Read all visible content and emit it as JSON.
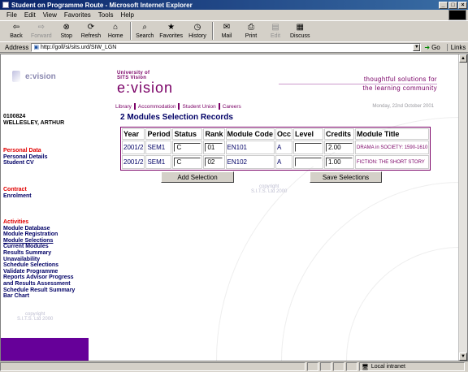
{
  "window": {
    "title": "Student on Programme Route - Microsoft Internet Explorer",
    "minimize": "_",
    "maximize": "□",
    "close": "×"
  },
  "menu": [
    "File",
    "Edit",
    "View",
    "Favorites",
    "Tools",
    "Help"
  ],
  "toolbar": {
    "back": "Back",
    "forward": "Forward",
    "stop": "Stop",
    "refresh": "Refresh",
    "home": "Home",
    "search": "Search",
    "favorites": "Favorites",
    "history": "History",
    "mail": "Mail",
    "print": "Print",
    "edit": "Edit",
    "discuss": "Discuss"
  },
  "address": {
    "label": "Address",
    "url": "http://goll/si/sits.urd/SIW_LGN",
    "go": "Go",
    "links": "Links"
  },
  "sidebar": {
    "logo_text": "e:vision",
    "student_id": "0100824",
    "student_name": "WELLESLEY, ARTHUR",
    "sections": [
      {
        "heading": "Personal Data",
        "items": [
          "Personal Details",
          "Student CV"
        ]
      },
      {
        "heading": "Contract",
        "items": [
          "Enrolment"
        ]
      },
      {
        "heading": "Activities",
        "items": [
          "Module Database",
          "Module Registration",
          "Module Selections",
          "Current Modules",
          "Results Summary",
          "Unavailability",
          "Schedule Selections",
          "Validate Programme",
          "Reports Advisor Progress",
          "and Results Assessment",
          "Schedule Result Summary",
          "Bar Chart"
        ]
      }
    ],
    "copyright_1": "copyright",
    "copyright_2": "S.I.T.S. Ltd 2000"
  },
  "header": {
    "logo_line1": "University of",
    "logo_line2": "SITS Vision",
    "logo_main": "e:vision",
    "tagline_1": "thoughtful solutions for",
    "tagline_2": "the learning community"
  },
  "nav": {
    "links": [
      "Library",
      "Accommodation",
      "Student Union",
      "Careers"
    ],
    "date": "Monday, 22nd October 2001"
  },
  "main": {
    "heading": "2 Modules Selection Records",
    "columns": [
      "Year",
      "Period",
      "Status",
      "Rank",
      "Module Code",
      "Occ",
      "Level",
      "Credits",
      "Module Title"
    ],
    "rows": [
      {
        "year": "2001/2",
        "period": "SEM1",
        "status": "C",
        "rank": "01",
        "code": "EN101",
        "occ": "A",
        "level": "",
        "credits": "2.00",
        "title": "DRAMA in SOCIETY: 1590-1610"
      },
      {
        "year": "2001/2",
        "period": "SEM1",
        "status": "C",
        "rank": "02",
        "code": "EN102",
        "occ": "A",
        "level": "",
        "credits": "1.00",
        "title": "FICTION: THE SHORT STORY"
      }
    ],
    "add_button": "Add Selection",
    "save_button": "Save Selections",
    "copyright_1": "copyright",
    "copyright_2": "S.I.T.S. Ltd 2000"
  },
  "status": {
    "zone": "Local intranet"
  }
}
